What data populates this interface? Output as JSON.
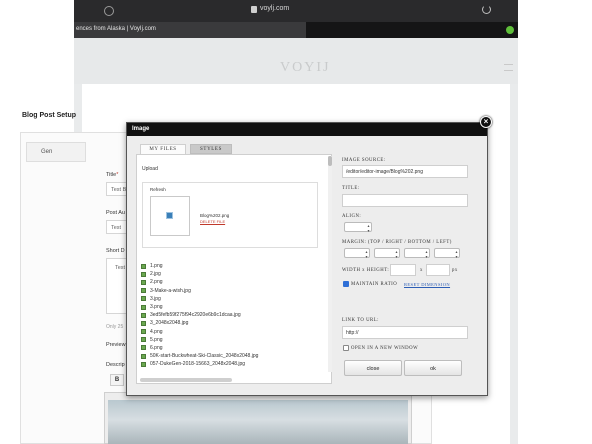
{
  "browser": {
    "url": "voylj.com",
    "tab_title": "ences from Alaska | VoyIj.com"
  },
  "site": {
    "logo": "VOYIJ"
  },
  "page": {
    "title": "Blog Post Setup",
    "panel_tab": "Gen",
    "title_label": "Title",
    "title_value": "Test B",
    "post_author_label": "Post Au",
    "post_author_value": "Test",
    "short_desc_label": "Short D",
    "short_desc_value": "Test",
    "note": "Only 25",
    "preview_label": "Preview",
    "description_label": "Descrip",
    "bold_label": "B"
  },
  "modal": {
    "title": "Image",
    "close": "×",
    "tabs": {
      "my_files": "MY FILES",
      "styles": "STYLES"
    },
    "upload_label": "Upload",
    "refresh_label": "Refresh",
    "thumb_name": "Blog%202.png",
    "thumb_delete": "DELETE FILE",
    "files": [
      "1.png",
      "2.jpg",
      "2.png",
      "3-Make-a-wish.jpg",
      "3.jpg",
      "3.png",
      "3ed5fefb59f275f94c2920e6b9c1dcaa.jpg",
      "3_2048x2048.jpg",
      "4.png",
      "5.png",
      "6.png",
      "50K-start-Buckwheat-Ski-Classic_2048x2048.jpg",
      "057-DukeGen-2018-15663_2048x2048.jpg"
    ],
    "image_source_label": "IMAGE SOURCE:",
    "image_source_value": "/editor/editor-image/Blog%202.png",
    "title_label": "TITLE:",
    "title_value": "",
    "align_label": "ALIGN:",
    "margin_label": "MARGIN: (TOP / RIGHT / BOTTOM / LEFT)",
    "width_height_label": "WIDTH x HEIGHT:",
    "x_sep": "x",
    "px_unit": "px",
    "maintain_ratio_label": "MAINTAIN RATIO",
    "reset_dimension_label": "RESET DIMENSION",
    "link_label": "LINK TO URL:",
    "link_value": "http://",
    "open_new_window_label": "OPEN IN A NEW WINDOW",
    "close_button": "close",
    "ok_button": "ok"
  }
}
